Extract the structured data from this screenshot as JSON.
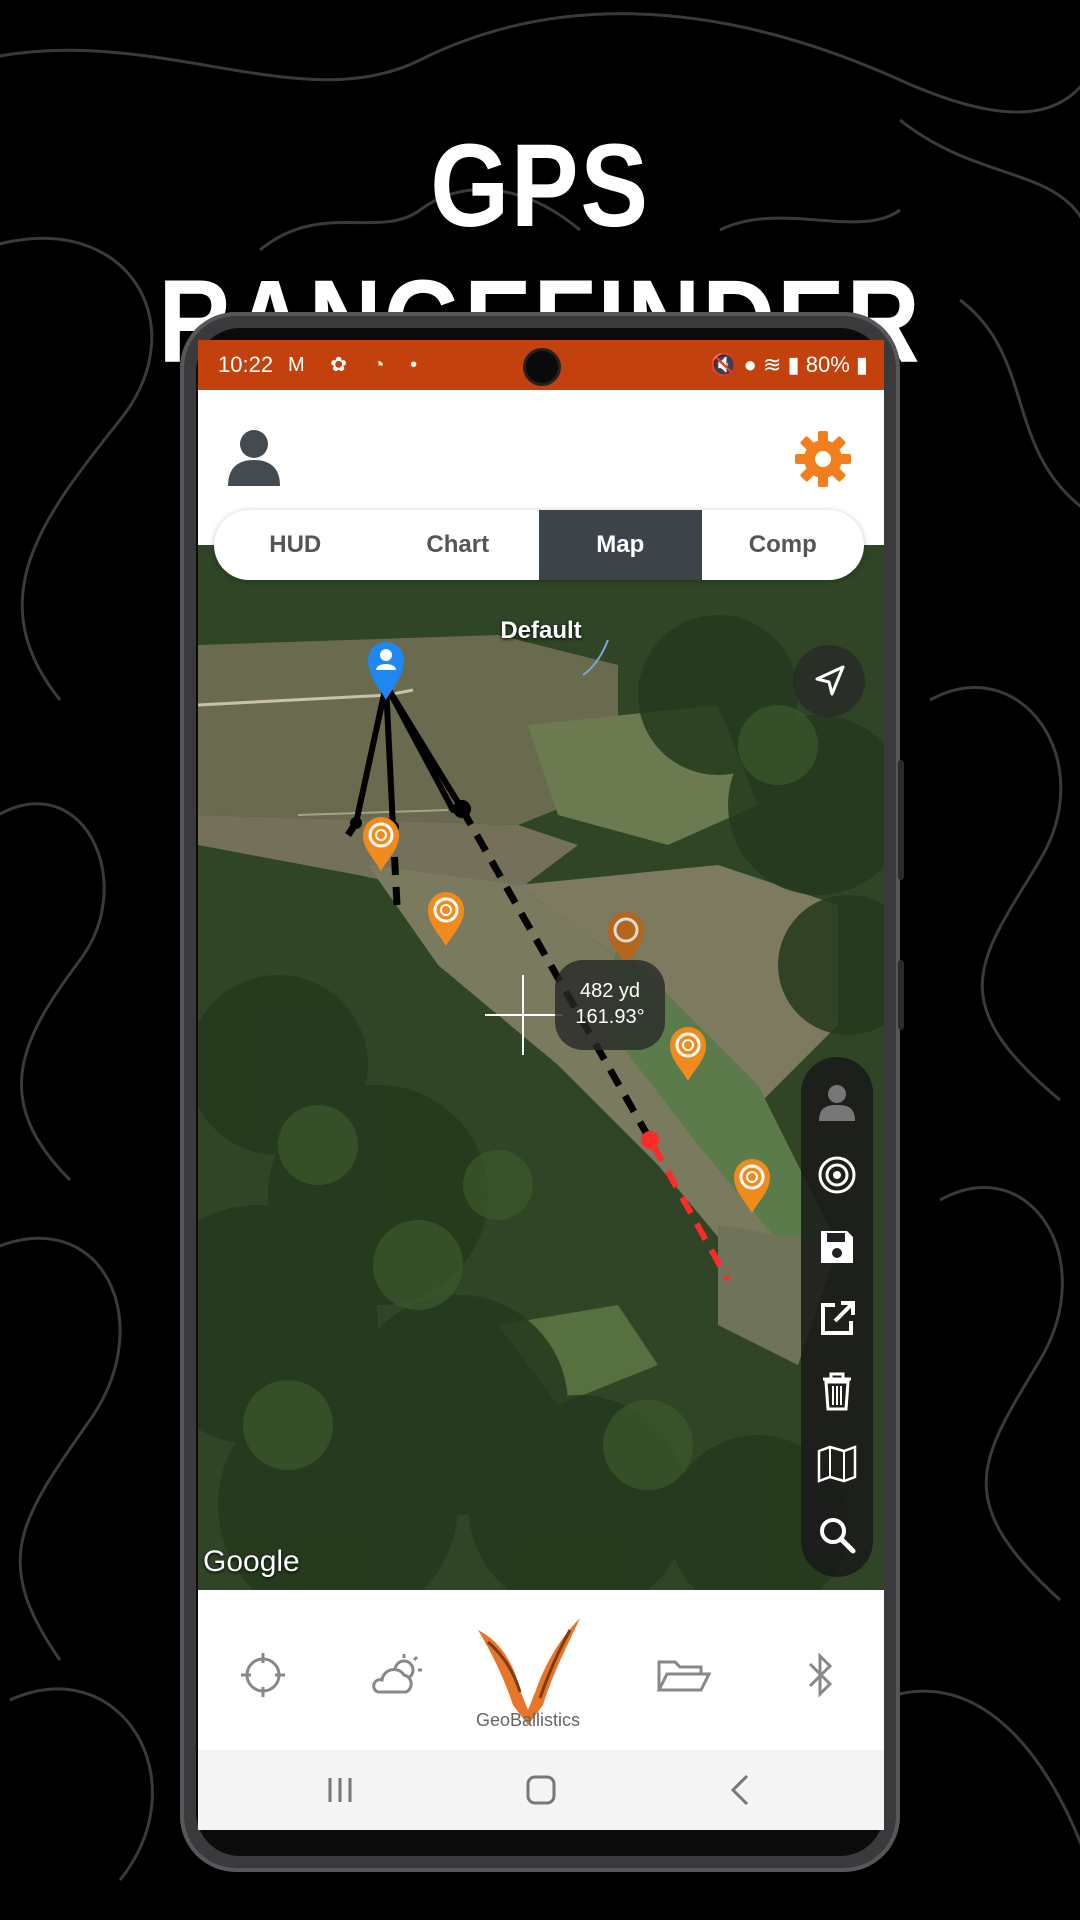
{
  "headline": "GPS RANGEFINDER",
  "status_bar": {
    "time": "10:22",
    "battery": "80%"
  },
  "tabs": [
    {
      "label": "HUD",
      "active": false
    },
    {
      "label": "Chart",
      "active": false
    },
    {
      "label": "Map",
      "active": true
    },
    {
      "label": "Comp",
      "active": false
    }
  ],
  "map": {
    "layer_label": "Default",
    "distance": "482 yd",
    "bearing": "161.93°",
    "attribution": "Google"
  },
  "toolbar_icons": [
    "person-icon",
    "target-icon",
    "save-icon",
    "share-icon",
    "trash-icon",
    "map-icon",
    "search-icon"
  ],
  "bottom_nav": [
    "crosshair-icon",
    "weather-icon",
    "geoballistics-logo",
    "folder-icon",
    "bluetooth-icon"
  ],
  "brand": {
    "name": "GeoBallistics",
    "accent": "#f07f1c",
    "status_color": "#c2410c"
  }
}
